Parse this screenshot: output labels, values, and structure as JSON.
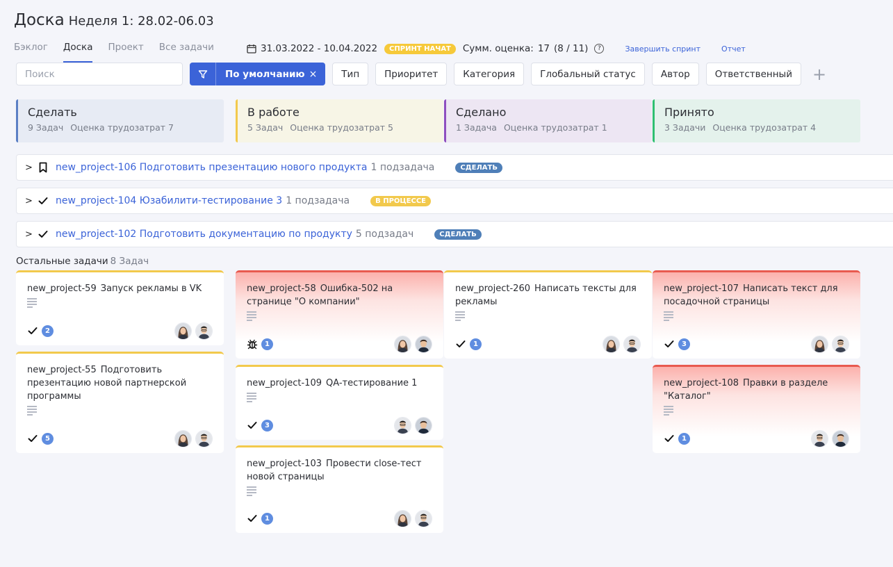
{
  "header": {
    "title": "Доска",
    "week": "Неделя 1: 28.02-06.03",
    "tabs": [
      "Бэклог",
      "Доска",
      "Проект",
      "Все задачи"
    ],
    "active_tab": "Доска"
  },
  "sprint": {
    "dates": "31.03.2022 - 10.04.2022",
    "status_badge": "СПРИНТ НАЧАТ",
    "sum_label": "Сумм. оценка:",
    "sum_value": "17",
    "sum_ratio": "(8 / 11)",
    "help_icon": "?",
    "finish_link": "Завершить спринт",
    "report_link": "Отчет"
  },
  "filters": {
    "search_placeholder": "Поиск",
    "default_filter": "По умолчанию",
    "clear_icon": "×",
    "chips": [
      "Тип",
      "Приоритет",
      "Категория",
      "Глобальный статус",
      "Автор",
      "Ответственный"
    ],
    "add_icon": "+"
  },
  "columns": [
    {
      "title": "Сделать",
      "tasks": "9 Задач",
      "estimate": "Оценка трудозатрат 7",
      "accent": "#5b7fc4",
      "bg": "#e7ebf4"
    },
    {
      "title": "В работе",
      "tasks": "5 Задач",
      "estimate": "Оценка трудозатрат 5",
      "accent": "#f2c94c",
      "bg": "#f7f5e6"
    },
    {
      "title": "Сделано",
      "tasks": "1 Задача",
      "estimate": "Оценка трудозатрат 1",
      "accent": "#8e4fbf",
      "bg": "#ede6f3"
    },
    {
      "title": "Принято",
      "tasks": "3 Задачи",
      "estimate": "Оценка трудозатрат 4",
      "accent": "#2fbf71",
      "bg": "#e4f2ec"
    }
  ],
  "epics": [
    {
      "icon": "bookmark-icon",
      "title": "new_project-106 Подготовить презентацию нового продукта",
      "subtasks": "1 подзадача",
      "status": "СДЕЛАТЬ",
      "status_color": "#4f7fb8"
    },
    {
      "icon": "check-icon",
      "title": "new_project-104 Юзабилити-тестирование 3",
      "subtasks": "1 подзадача",
      "status": "В ПРОЦЕССЕ",
      "status_color": "#f2c94c"
    },
    {
      "icon": "check-icon",
      "title": "new_project-102 Подготовить документацию по продукту",
      "subtasks": "5 подзадач",
      "status": "СДЕЛАТЬ",
      "status_color": "#4f7fb8"
    }
  ],
  "others": {
    "label": "Остальные задачи",
    "count": "8 Задач"
  },
  "cards": [
    {
      "key": "new_project-59",
      "title": "Запуск рекламы в VK",
      "type_icon": "check-icon",
      "count": "2"
    },
    {
      "key": "new_project-55",
      "title": "Подготовить презентацию новой партнерской программы",
      "type_icon": "check-icon",
      "count": "5"
    },
    {
      "key": "new_project-58",
      "title": "Ошибка-502 на странице \"О компании\"",
      "type_icon": "bug-icon",
      "count": "1"
    },
    {
      "key": "new_project-109",
      "title": "QA-тестирование 1",
      "type_icon": "check-icon",
      "count": "3"
    },
    {
      "key": "new_project-103",
      "title": "Провести close-тест новой страницы",
      "type_icon": "check-icon",
      "count": "1"
    },
    {
      "key": "new_project-260",
      "title": "Написать тексты для рекламы",
      "type_icon": "check-icon",
      "count": "1"
    },
    {
      "key": "new_project-107",
      "title": "Написать текст для посадочной страницы",
      "type_icon": "check-icon",
      "count": "3"
    },
    {
      "key": "new_project-108",
      "title": "Правки в разделе \"Каталог\"",
      "type_icon": "check-icon",
      "count": "1"
    }
  ]
}
